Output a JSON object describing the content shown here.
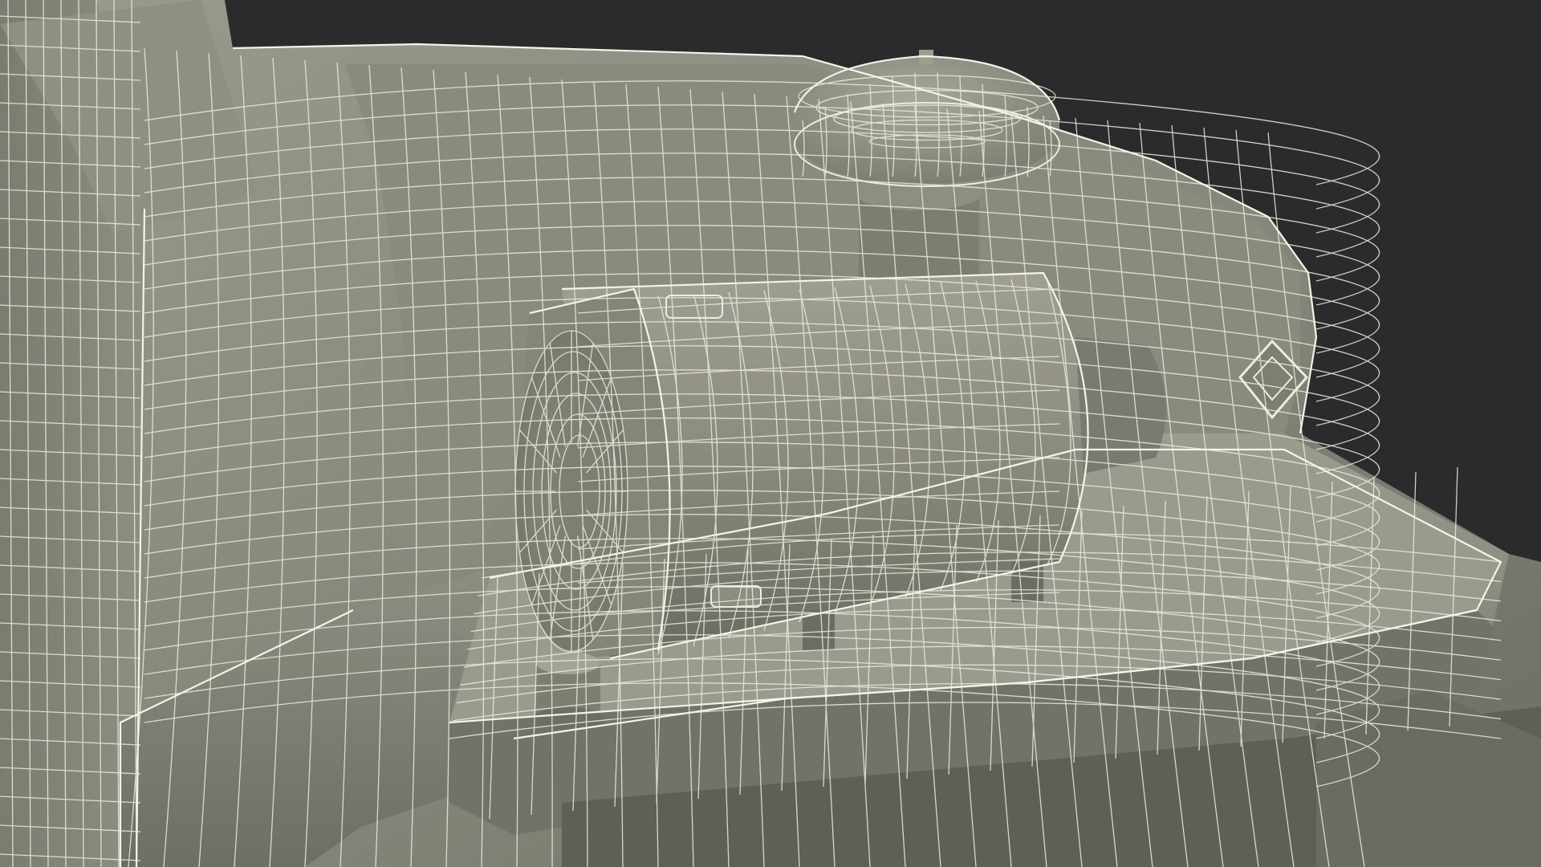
{
  "scene": {
    "colors": {
      "background": "#2a2b2c",
      "surface": "#8b8b7f",
      "surface_dark": "#66665c",
      "surface_light": "#a3a398",
      "wire": "#ecece0"
    }
  }
}
